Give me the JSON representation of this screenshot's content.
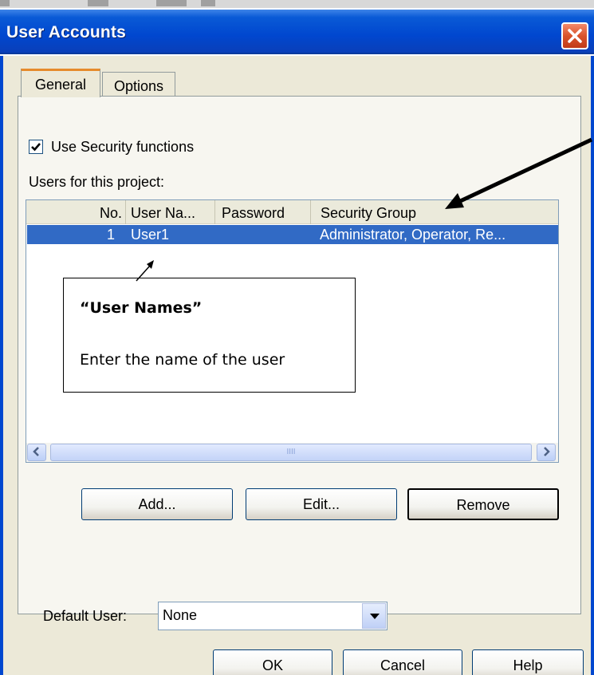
{
  "window": {
    "title": "User Accounts"
  },
  "tabs": [
    {
      "label": "General"
    },
    {
      "label": "Options"
    }
  ],
  "security": {
    "checkbox_label": "Use Security functions",
    "checked": true
  },
  "users_label": "Users for this project:",
  "table": {
    "columns": [
      "No.",
      "User Na...",
      "Password",
      "Security Group"
    ],
    "rows": [
      {
        "no": "1",
        "user": "User1",
        "password": "",
        "group": "Administrator, Operator, Re..."
      }
    ]
  },
  "callout": {
    "title": "“User Names”",
    "text": "Enter the name of the user"
  },
  "buttons": {
    "add": "Add...",
    "edit": "Edit...",
    "remove": "Remove",
    "ok": "OK",
    "cancel": "Cancel",
    "help": "Help"
  },
  "default_user": {
    "label": "Default User:",
    "value": "None"
  },
  "icons": {
    "close": "close-icon",
    "check": "checkmark-icon",
    "scroll_left": "chevron-left-icon",
    "scroll_right": "chevron-right-icon",
    "dropdown": "chevron-down-icon"
  },
  "colors": {
    "titlebar": "#0047cf",
    "selection": "#316ac5",
    "close": "#d9532b",
    "dialog": "#ece9d8"
  }
}
